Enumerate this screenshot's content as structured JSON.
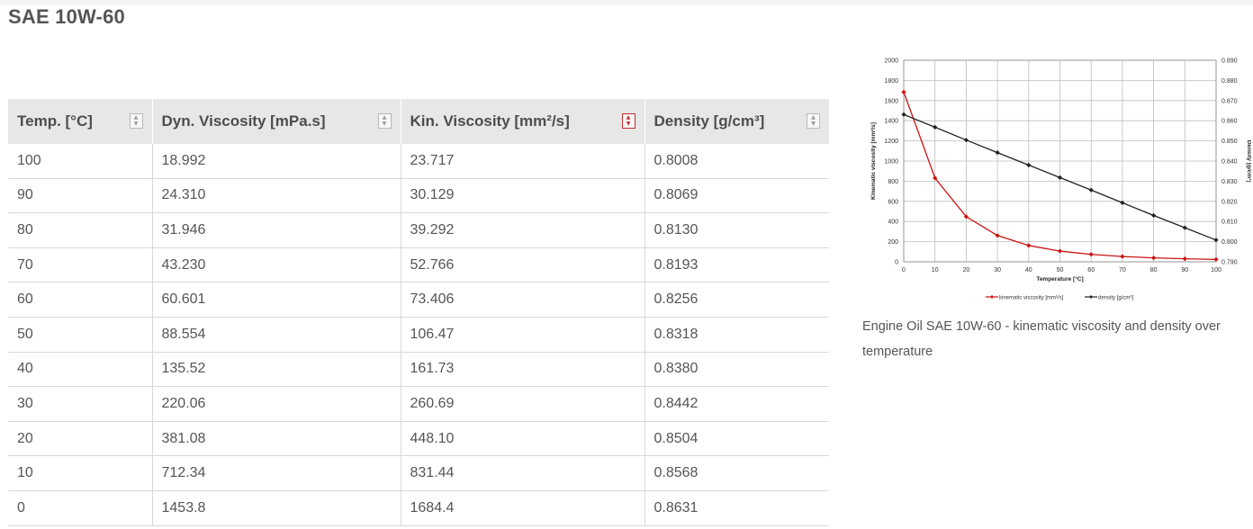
{
  "page_title": "SAE 10W-60",
  "table": {
    "headers": [
      {
        "label": "Temp. [°C]",
        "sort_icon": "sort-icon",
        "active": false
      },
      {
        "label": "Dyn. Viscosity [mPa.s]",
        "sort_icon": "sort-icon",
        "active": false
      },
      {
        "label": "Kin. Viscosity [mm²/s]",
        "sort_icon": "sort-icon",
        "active": true
      },
      {
        "label": "Density [g/cm³]",
        "sort_icon": "sort-icon",
        "active": false
      }
    ],
    "rows": [
      [
        "100",
        "18.992",
        "23.717",
        "0.8008"
      ],
      [
        "90",
        "24.310",
        "30.129",
        "0.8069"
      ],
      [
        "80",
        "31.946",
        "39.292",
        "0.8130"
      ],
      [
        "70",
        "43.230",
        "52.766",
        "0.8193"
      ],
      [
        "60",
        "60.601",
        "73.406",
        "0.8256"
      ],
      [
        "50",
        "88.554",
        "106.47",
        "0.8318"
      ],
      [
        "40",
        "135.52",
        "161.73",
        "0.8380"
      ],
      [
        "30",
        "220.06",
        "260.69",
        "0.8442"
      ],
      [
        "20",
        "381.08",
        "448.10",
        "0.8504"
      ],
      [
        "10",
        "712.34",
        "831.44",
        "0.8568"
      ],
      [
        "0",
        "1453.8",
        "1684.4",
        "0.8631"
      ]
    ]
  },
  "chart_data": {
    "type": "line",
    "x": [
      0,
      10,
      20,
      30,
      40,
      50,
      60,
      70,
      80,
      90,
      100
    ],
    "xlabel": "Temperature  [°C]",
    "ylabel": "Kinematic viscosity  [mm²/s]",
    "y2label": "Density  [g/cm³]",
    "xlim": [
      0,
      100
    ],
    "ylim": [
      0,
      2000
    ],
    "y2lim": [
      0.79,
      0.89
    ],
    "xticks": [
      "0",
      "10",
      "20",
      "30",
      "40",
      "50",
      "60",
      "70",
      "80",
      "90",
      "100"
    ],
    "yticks": [
      "0",
      "200",
      "400",
      "600",
      "800",
      "1000",
      "1200",
      "1400",
      "1600",
      "1800",
      "2000"
    ],
    "y2ticks": [
      "0.790",
      "0.800",
      "0.810",
      "0.820",
      "0.830",
      "0.840",
      "0.850",
      "0.860",
      "0.870",
      "0.880",
      "0.890"
    ],
    "grid": true,
    "legend_position": "bottom",
    "series": [
      {
        "name": "kinematic viscosity [mm²/s]",
        "axis": "left",
        "color": "#cc1111",
        "values": [
          1684.4,
          831.44,
          448.1,
          260.69,
          161.73,
          106.47,
          73.406,
          52.766,
          39.292,
          30.129,
          23.717
        ]
      },
      {
        "name": "density [g/cm³]",
        "axis": "right",
        "color": "#222222",
        "values": [
          0.8631,
          0.8568,
          0.8504,
          0.8442,
          0.838,
          0.8318,
          0.8256,
          0.8193,
          0.813,
          0.8069,
          0.8008
        ]
      }
    ]
  },
  "caption": "Engine Oil SAE 10W-60 - kinematic viscosity and density over temperature"
}
